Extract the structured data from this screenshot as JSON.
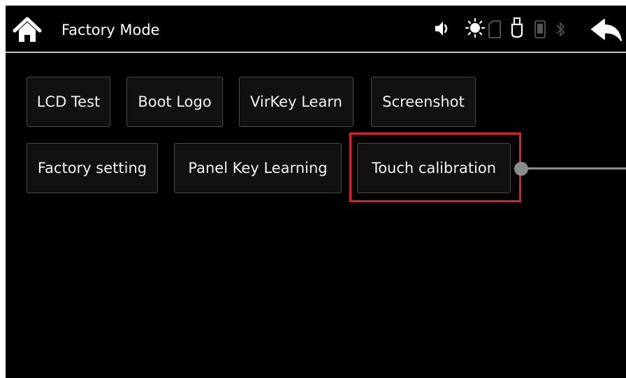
{
  "header": {
    "title": "Factory Mode",
    "home_icon": "home-icon",
    "back_icon": "back-arrow-icon"
  },
  "status_icons": [
    "speaker-icon",
    "brightness-icon",
    "sd-card-icon",
    "usb-icon",
    "phone-icon",
    "bluetooth-icon"
  ],
  "buttons": {
    "lcd_test": "LCD Test",
    "boot_logo": "Boot Logo",
    "virkey_learn": "VirKey Learn",
    "screenshot": "Screenshot",
    "factory_setting": "Factory setting",
    "panel_key_learning": "Panel Key Learning",
    "touch_calibration": "Touch calibration"
  },
  "colors": {
    "background": "#000000",
    "highlight": "#d8232f",
    "callout": "#8c8c8c",
    "divider": "#bfbfbf"
  }
}
